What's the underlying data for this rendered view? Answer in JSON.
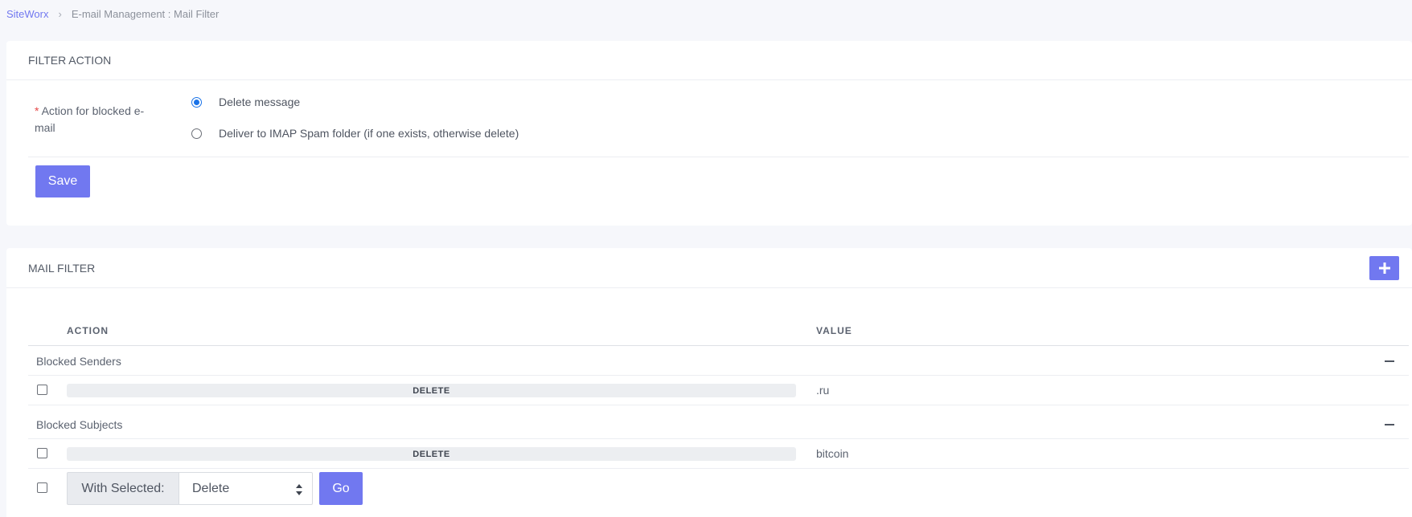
{
  "breadcrumb": {
    "root": "SiteWorx",
    "separator": "›",
    "current": "E-mail Management : Mail Filter"
  },
  "filter_action": {
    "title": "FILTER ACTION",
    "required_marker": "*",
    "field_label": "Action for blocked e-mail",
    "options": [
      {
        "label": "Delete message",
        "selected": true
      },
      {
        "label": "Deliver to IMAP Spam folder (if one exists, otherwise delete)",
        "selected": false
      }
    ],
    "save_label": "Save"
  },
  "mail_filter": {
    "title": "MAIL FILTER",
    "add_icon": "plus-icon",
    "columns": [
      "ACTION",
      "VALUE"
    ],
    "groups": [
      {
        "name": "Blocked Senders",
        "rows": [
          {
            "action": "DELETE",
            "value": ".ru",
            "checked": false
          }
        ]
      },
      {
        "name": "Blocked Subjects",
        "rows": [
          {
            "action": "DELETE",
            "value": "bitcoin",
            "checked": false
          }
        ]
      }
    ],
    "bulk": {
      "with_selected_label": "With Selected:",
      "selected_option": "Delete",
      "go_label": "Go"
    }
  },
  "colors": {
    "accent": "#7178f0",
    "radio_selected": "#1a73e8",
    "required": "#e54848"
  }
}
